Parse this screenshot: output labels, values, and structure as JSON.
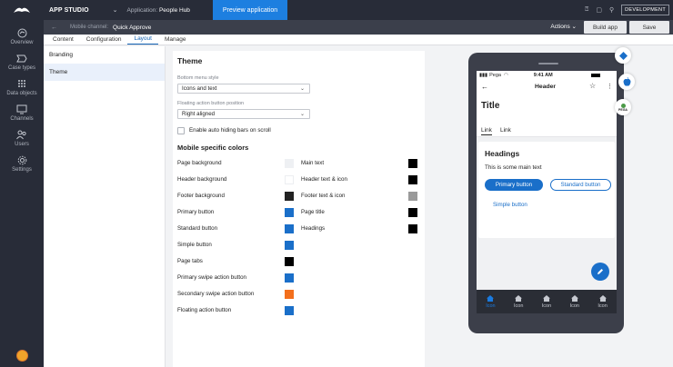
{
  "topbar": {
    "app_name": "APP STUDIO",
    "app_chevron": "⌄",
    "application_label": "Application:",
    "application_name": "People Hub",
    "preview_label": "Preview application",
    "dev_badge": "DEVELOPMENT"
  },
  "subbar": {
    "channel_label": "Mobile channel:",
    "channel_name": "Quick Approve",
    "actions_label": "Actions",
    "build_label": "Build app",
    "save_label": "Save"
  },
  "leftnav": {
    "items": [
      {
        "label": "Overview",
        "icon": "overview-icon"
      },
      {
        "label": "Case types",
        "icon": "case-types-icon"
      },
      {
        "label": "Data objects",
        "icon": "data-objects-icon"
      },
      {
        "label": "Channels",
        "icon": "channels-icon"
      },
      {
        "label": "Users",
        "icon": "users-icon"
      },
      {
        "label": "Settings",
        "icon": "settings-icon"
      }
    ]
  },
  "tabs": [
    "Content",
    "Configuration",
    "Layout",
    "Manage"
  ],
  "active_tab": "Layout",
  "sidepanel": {
    "items": [
      "Branding",
      "Theme"
    ],
    "selected": "Theme"
  },
  "theme": {
    "title": "Theme",
    "bottom_menu_label": "Bottom menu style",
    "bottom_menu_value": "Icons and text",
    "fab_position_label": "Floating action button position",
    "fab_position_value": "Right aligned",
    "auto_hide_label": "Enable auto hiding bars on scroll",
    "auto_hide_checked": false,
    "colors_heading": "Mobile specific colors",
    "left_colors": [
      {
        "label": "Page background",
        "color": "#eef0f3"
      },
      {
        "label": "Header background",
        "color": "#ffffff"
      },
      {
        "label": "Footer background",
        "color": "#222222"
      },
      {
        "label": "Primary button",
        "color": "#1a6fc9"
      },
      {
        "label": "Standard button",
        "color": "#1a6fc9"
      },
      {
        "label": "Simple button",
        "color": "#1a6fc9"
      },
      {
        "label": "Page tabs",
        "color": "#000000"
      },
      {
        "label": "Primary swipe action button",
        "color": "#1a6fc9"
      },
      {
        "label": "Secondary swipe action button",
        "color": "#f36f1c"
      },
      {
        "label": "Floating action button",
        "color": "#1a6fc9"
      }
    ],
    "right_colors": [
      {
        "label": "Main text",
        "color": "#000000"
      },
      {
        "label": "Header text & icon",
        "color": "#000000"
      },
      {
        "label": "Footer text & icon",
        "color": "#9a9a9a"
      },
      {
        "label": "Page title",
        "color": "#000000"
      },
      {
        "label": "Headings",
        "color": "#000000"
      }
    ]
  },
  "phone": {
    "carrier": "Pega",
    "time": "9:41 AM",
    "header": "Header",
    "page_title": "Title",
    "tabs": [
      "Link",
      "Link"
    ],
    "headings": "Headings",
    "main_text": "This is some main text",
    "primary_button": "Primary button",
    "standard_button": "Standard button",
    "simple_button": "Simple button",
    "footer_items": [
      "Icon",
      "Icon",
      "Icon",
      "Icon",
      "Icon"
    ],
    "pega_badge": "PEGA"
  },
  "colors": {
    "accent": "#1d7fe0",
    "topbar": "#282c38",
    "subbar": "#3b3f4b"
  }
}
